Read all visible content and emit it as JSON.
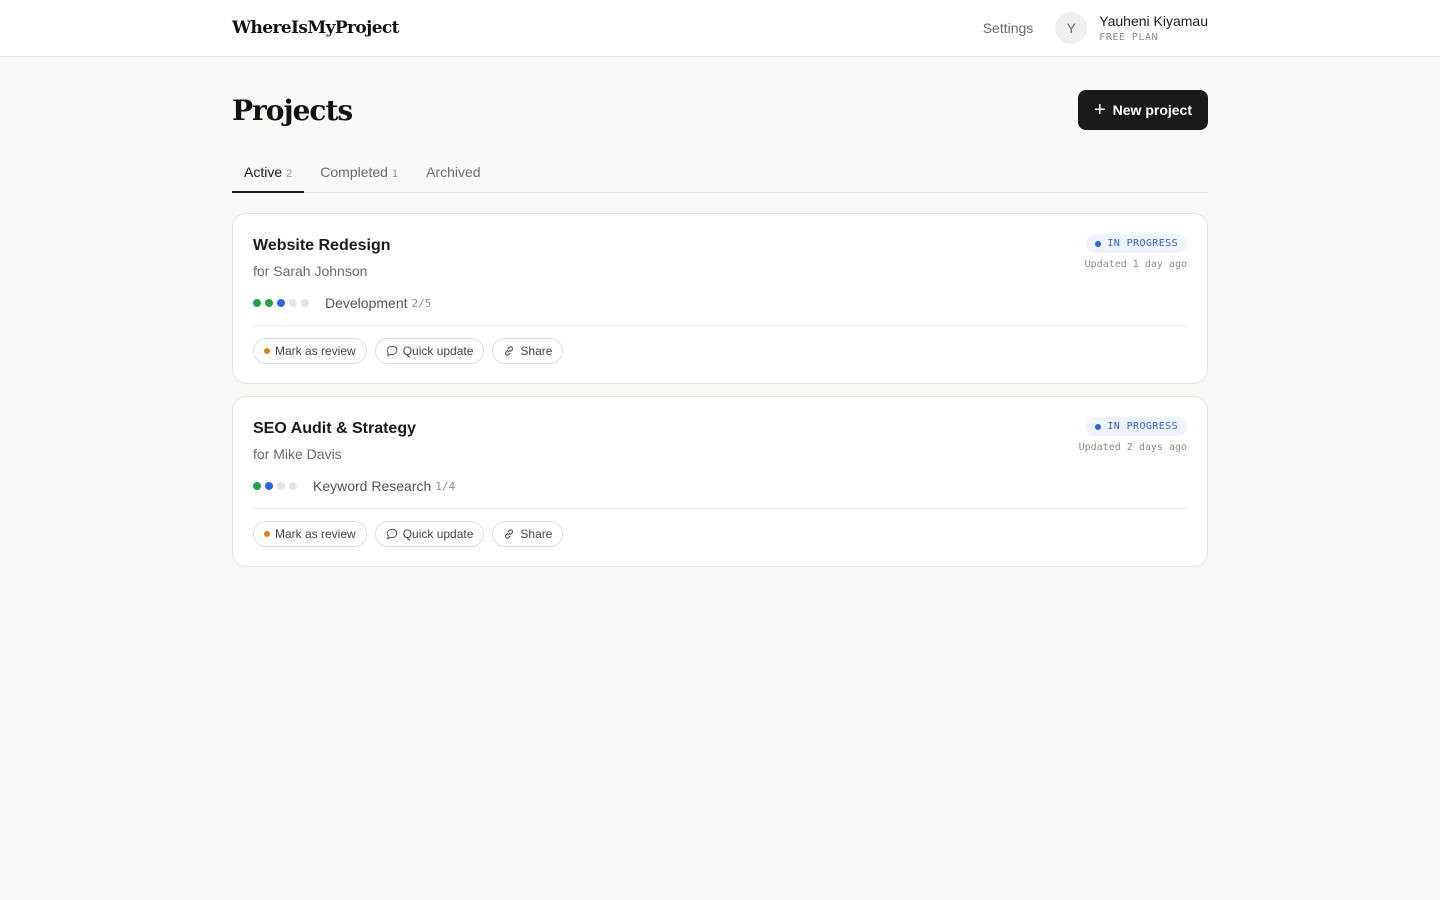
{
  "header": {
    "logo": "WhereIsMyProject",
    "settings_label": "Settings",
    "user": {
      "initial": "Y",
      "name": "Yauheni Kiyamau",
      "plan": "FREE PLAN"
    }
  },
  "page": {
    "title": "Projects",
    "new_button_label": "New project",
    "new_button_icon": "plus-icon"
  },
  "tabs": [
    {
      "label": "Active",
      "count": "2",
      "active": true
    },
    {
      "label": "Completed",
      "count": "1",
      "active": false
    },
    {
      "label": "Archived",
      "count": "",
      "active": false
    }
  ],
  "projects": [
    {
      "title": "Website Redesign",
      "client": "for Sarah Johnson",
      "status": "IN PROGRESS",
      "updated": "Updated 1 day ago",
      "stage": "Development",
      "stage_count": "2/5",
      "stage_progress": {
        "done": 2,
        "current": 1,
        "remaining": 2
      },
      "actions": {
        "review": "Mark as review",
        "update": "Quick update",
        "share": "Share"
      }
    },
    {
      "title": "SEO Audit & Strategy",
      "client": "for Mike Davis",
      "status": "IN PROGRESS",
      "updated": "Updated 2 days ago",
      "stage": "Keyword Research",
      "stage_count": "1/4",
      "stage_progress": {
        "done": 1,
        "current": 1,
        "remaining": 2
      },
      "actions": {
        "review": "Mark as review",
        "update": "Quick update",
        "share": "Share"
      }
    }
  ],
  "colors": {
    "accent_dark": "#1a1a1a",
    "status_blue": "#2f63e0",
    "done_green": "#22a04b",
    "review_orange": "#d9821c"
  }
}
